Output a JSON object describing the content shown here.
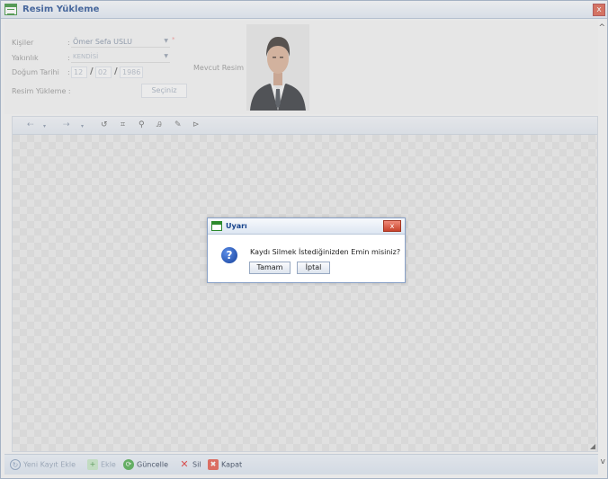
{
  "window": {
    "title": "Resim Yükleme",
    "close_label": "x"
  },
  "form": {
    "kisiler_label": "Kişiler",
    "kisiler_value": "Ömer Sefa USLU",
    "yakinlik_label": "Yakınlık",
    "yakinlik_value": "KENDİSİ",
    "dogum_label": "Doğum Tarihi",
    "dogum_day": "12",
    "dogum_month": "02",
    "dogum_year": "1986",
    "date_separator": "/",
    "colon": ":",
    "resim_label": "Resim Yükleme :",
    "seciniz_label": "Seçiniz",
    "mevcut_label": "Mevcut Resim :"
  },
  "toolbar": {
    "icons": [
      "undo-icon",
      "redo-icon",
      "rotate-icon",
      "crop-icon",
      "zoom-icon",
      "text-icon",
      "draw-icon",
      "flip-icon"
    ]
  },
  "bottombar": {
    "items": [
      {
        "label": "Yeni Kayıt Ekle",
        "icon": "refresh-icon",
        "enabled": false
      },
      {
        "label": "Ekle",
        "icon": "add-icon",
        "enabled": false
      },
      {
        "label": "Güncelle",
        "icon": "update-icon",
        "enabled": true
      },
      {
        "label": "Sil",
        "icon": "delete-icon",
        "enabled": true
      },
      {
        "label": "Kapat",
        "icon": "close-icon",
        "enabled": true
      }
    ]
  },
  "dialog": {
    "title": "Uyarı",
    "message": "Kaydı Silmek İstediğinizden Emin misiniz?",
    "ok_label": "Tamam",
    "cancel_label": "İptal"
  },
  "colors": {
    "accent": "#15428b",
    "question": "#16419b",
    "close": "#c8432c"
  }
}
